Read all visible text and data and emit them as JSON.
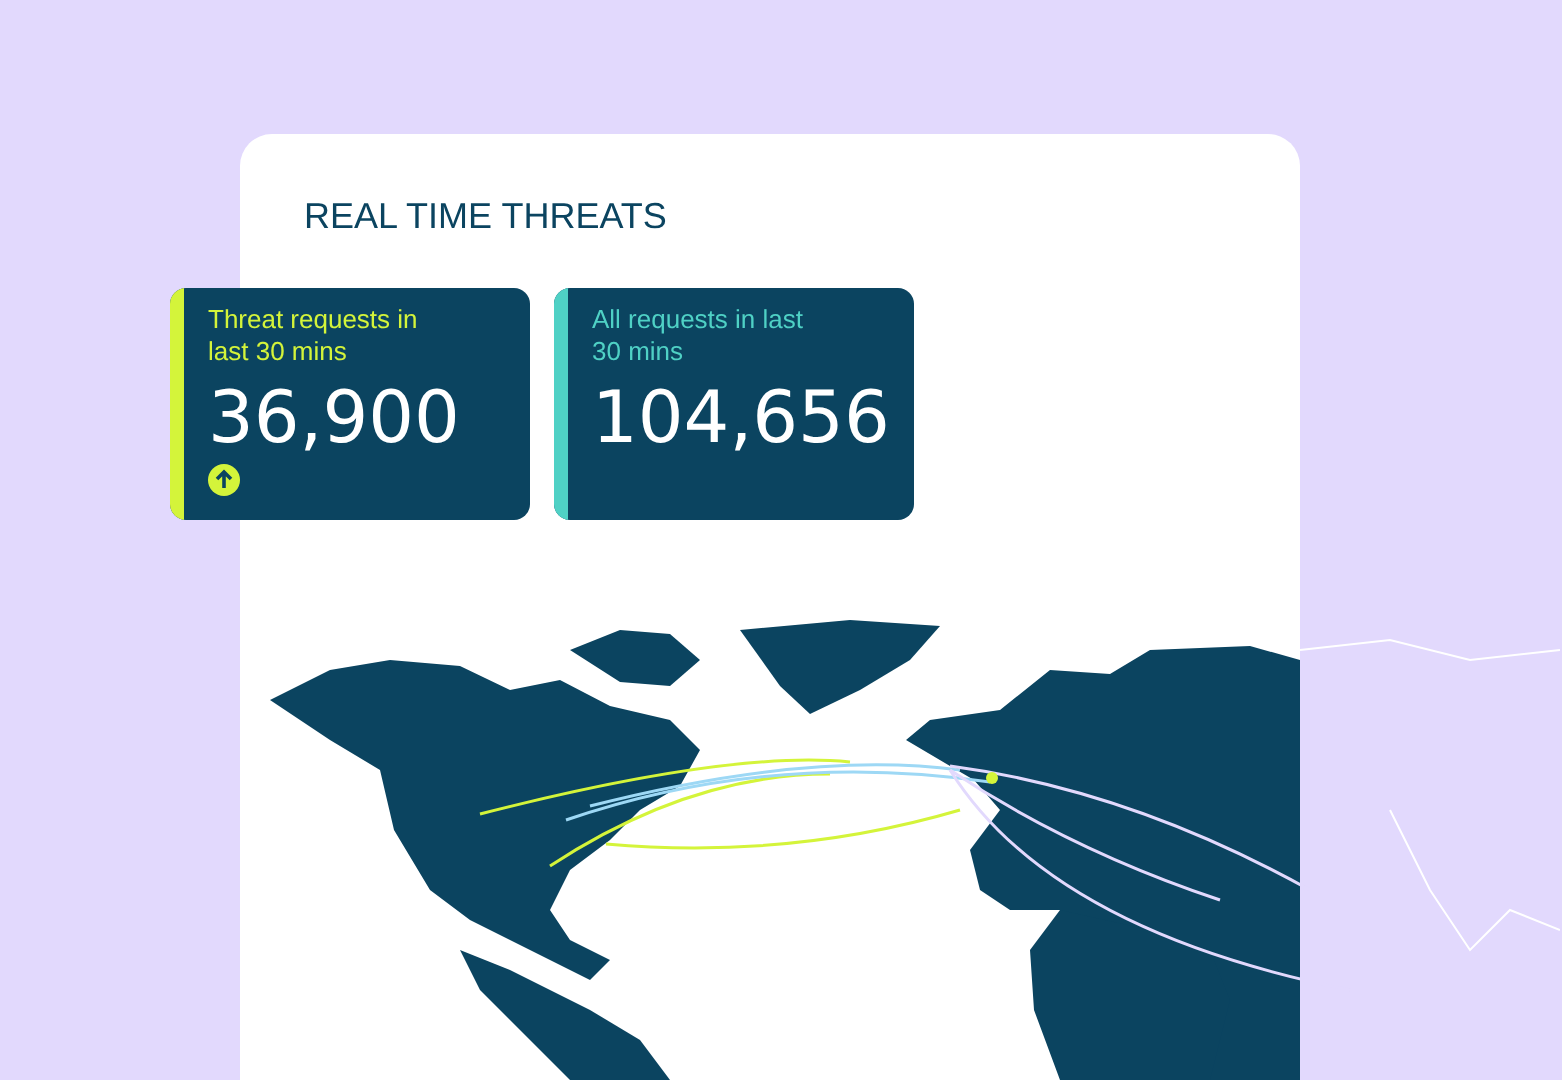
{
  "panel": {
    "title": "REAL TIME THREATS"
  },
  "stats": [
    {
      "label": "Threat requests in last 30 mins",
      "value": "36,900",
      "color": "#d4f43a",
      "trending_up": true
    },
    {
      "label": "All requests in last 30 mins",
      "value": "104,656",
      "color": "#4fd1c5",
      "trending_up": false
    }
  ]
}
